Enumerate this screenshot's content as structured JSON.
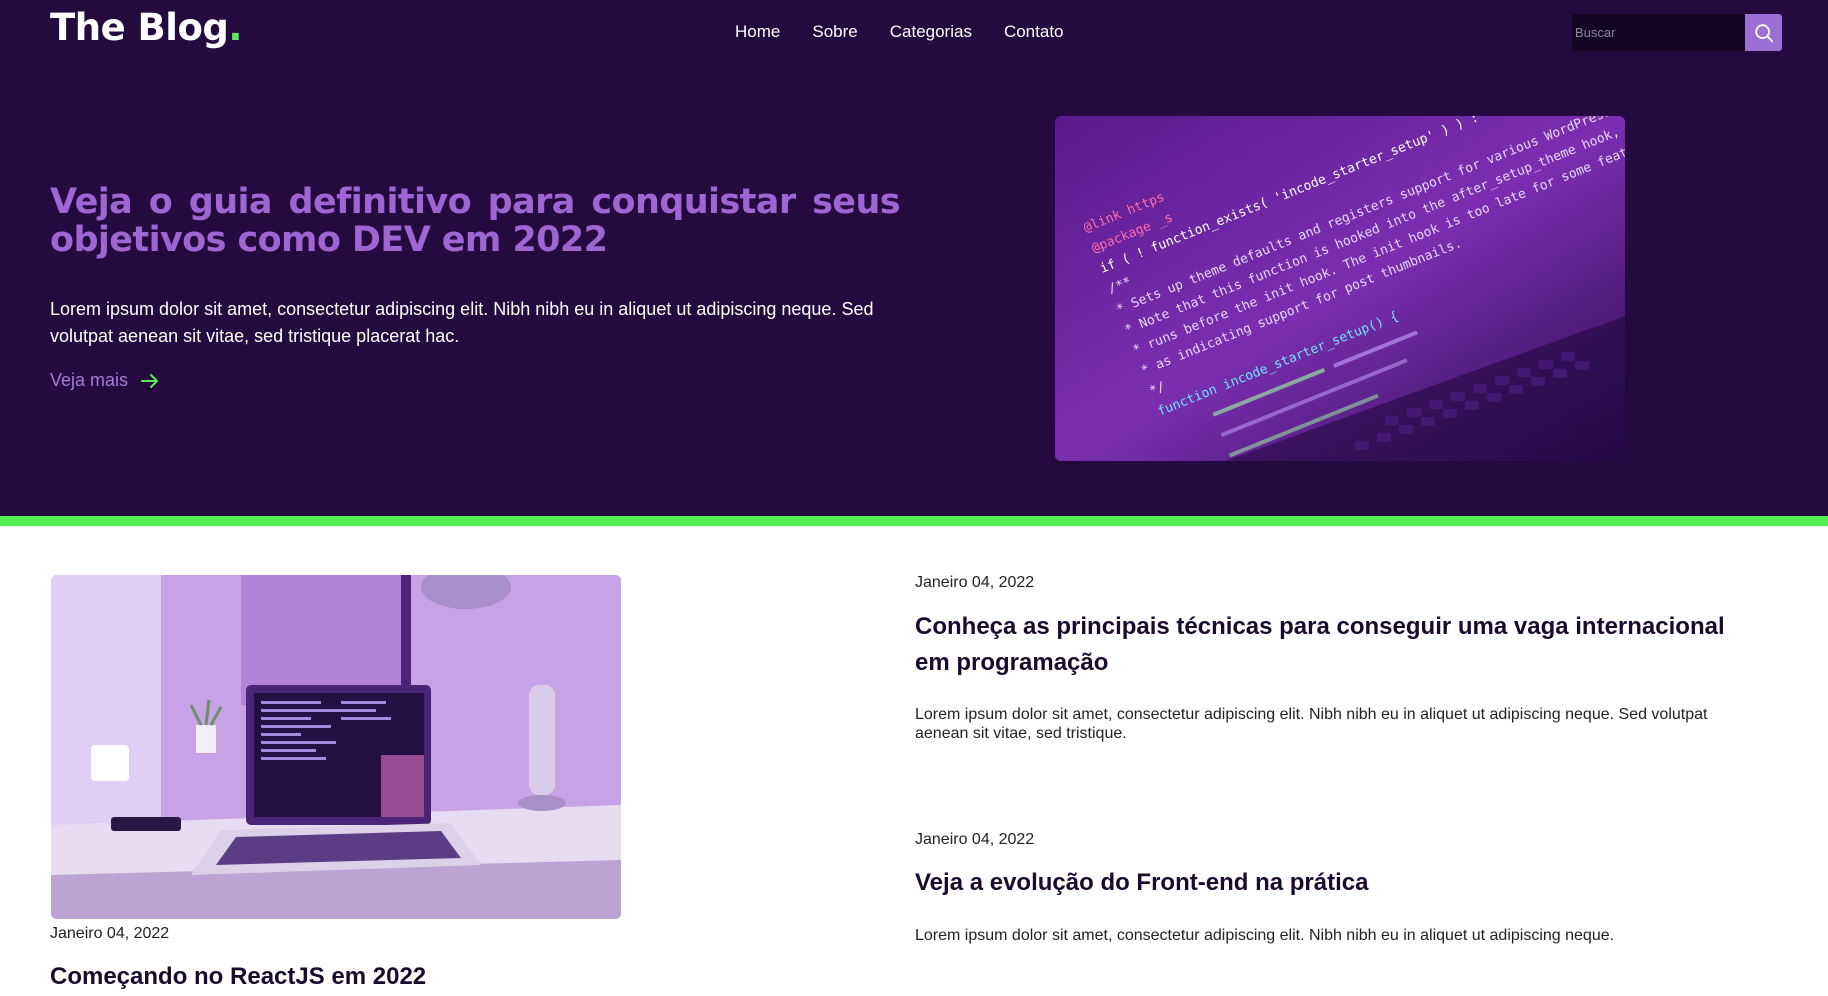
{
  "brand": {
    "name": "The Blog",
    "dot": ".",
    "dot_color": "#55ee55"
  },
  "nav": {
    "items": [
      "Home",
      "Sobre",
      "Categorias",
      "Contato"
    ]
  },
  "search": {
    "placeholder": "Buscar",
    "value": "",
    "icon": "search-icon"
  },
  "hero": {
    "title": "Veja o guia definitivo para conquistar seus objetivos como DEV em 2022",
    "text": "Lorem ipsum dolor sit amet, consectetur adipiscing elit. Nibh nibh eu in aliquet ut adipiscing neque. Sed volutpat aenean sit vitae, sed tristique placerat hac.",
    "read_more": "Veja mais",
    "read_more_icon": "arrow-right-icon",
    "image": "code-on-laptop-screen",
    "code_lines": [
      "@link https",
      "@package _s",
      "if ( ! function_exists( 'incode_starter_setup' ) ) :",
      "/**",
      " * Sets up theme defaults and registers support for various WordPress features.",
      " * Note that this function is hooked into the after_setup_theme hook, which",
      " * runs before the init hook. The init hook is too late for some features,",
      " * as indicating support for post thumbnails.",
      " */",
      "function incode_starter_setup() {"
    ]
  },
  "colors": {
    "hero_bg": "#250a3f",
    "accent_purple": "#9d66d2",
    "accent_green": "#55ee55",
    "search_button": "#9b6fd6",
    "title_dark": "#1a0b2e"
  },
  "posts": [
    {
      "date": "Janeiro 04, 2022",
      "title": "Conheça as principais técnicas para conseguir uma vaga internacional em programação",
      "text": "Lorem ipsum dolor sit amet, consectetur adipiscing elit. Nibh nibh eu in aliquet ut adipiscing neque. Sed volutpat aenean sit vitae, sed tristique."
    },
    {
      "date": "Janeiro 04, 2022",
      "title": "Veja a evolução do Front-end na prática",
      "text": "Lorem ipsum dolor sit amet, consectetur adipiscing elit. Nibh nibh eu in aliquet ut adipiscing neque."
    },
    {
      "date": "Janeiro 04, 2022",
      "title": "Começando no ReactJS em 2022",
      "image": "laptop-on-desk"
    }
  ]
}
